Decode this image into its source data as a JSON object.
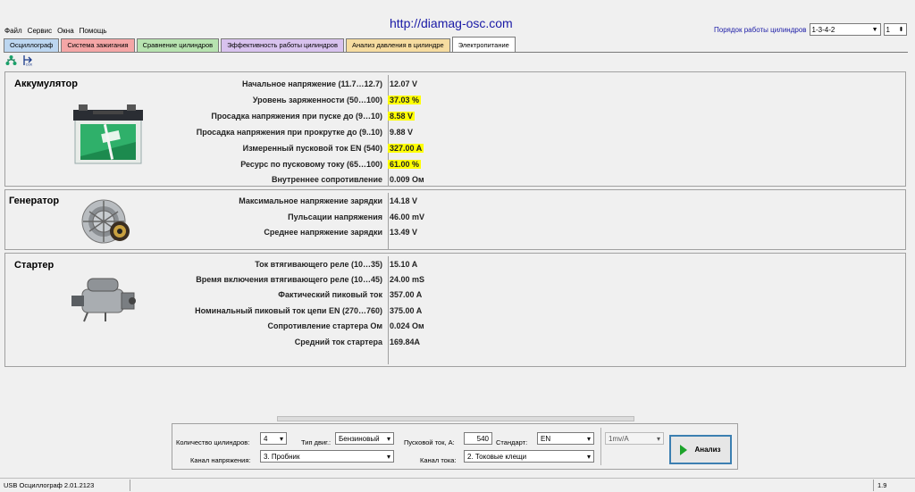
{
  "site_url": "http://diamag-osc.com",
  "menu": [
    "Файл",
    "Сервис",
    "Окна",
    "Помощь"
  ],
  "cylinder_order": {
    "label": "Порядок работы цилиндров",
    "value": "1-3-4-2",
    "stepper": "1"
  },
  "tabs": [
    {
      "label": "Осциллограф",
      "color": "#bcd6f0"
    },
    {
      "label": "Система зажигания",
      "color": "#f4a6a6"
    },
    {
      "label": "Сравнение цилиндров",
      "color": "#b7e3b0"
    },
    {
      "label": "Эффективность работы цилиндров",
      "color": "#d8c2ee"
    },
    {
      "label": "Анализ давления в цилиндре",
      "color": "#f6dca0"
    },
    {
      "label": "Электропитание",
      "color": "#ffffff",
      "active": true
    }
  ],
  "toolbar_icons": [
    "network-icon",
    "export-icon"
  ],
  "battery": {
    "title": "Аккумулятор",
    "rows": [
      {
        "label": "Начальное напряжение (11.7…12.7)",
        "value": "12.07 V",
        "highlight": false
      },
      {
        "label": "Уровень заряженности (50…100)",
        "value": "37.03 %",
        "highlight": true
      },
      {
        "label": "Просадка напряжения при пуске до (9…10)",
        "value": "8.58 V",
        "highlight": true
      },
      {
        "label": "Просадка напряжения при прокрутке до  (9..10)",
        "value": "9.88 V",
        "highlight": false
      },
      {
        "label": "Измеренный пусковой ток  EN (540)",
        "value": "327.00 A",
        "highlight": true
      },
      {
        "label": "Ресурс по пусковому току (65…100)",
        "value": "61.00 %",
        "highlight": true
      },
      {
        "label": "Внутреннее сопротивление",
        "value": "0.009 Ом",
        "highlight": false
      }
    ]
  },
  "generator": {
    "title": "Генератор",
    "rows": [
      {
        "label": "Максимальное напряжение зарядки",
        "value": "14.18 V"
      },
      {
        "label": "Пульсации напряжения",
        "value": "46.00 mV"
      },
      {
        "label": "Среднее напряжение зарядки",
        "value": "13.49 V"
      }
    ]
  },
  "starter": {
    "title": "Стартер",
    "rows": [
      {
        "label": "Ток втягивающего реле (10…35)",
        "value": "15.10 A"
      },
      {
        "label": "Время включения втягивающего реле (10…45)",
        "value": "24.00 mS"
      },
      {
        "label": "Фактический пиковый ток",
        "value": "357.00 A"
      },
      {
        "label": "Номинальный пиковый ток цепи EN (270…760)",
        "value": "375.00 A"
      },
      {
        "label": "Сопротивление стартера Ом",
        "value": "0.024 Ом"
      },
      {
        "label": "Средний ток стартера",
        "value": "169.84A"
      }
    ]
  },
  "controls": {
    "cyl_count_label": "Количество цилиндров:",
    "cyl_count_value": "4",
    "engine_type_label": "Тип двиг.:",
    "engine_type_value": "Бензиновый",
    "start_current_label": "Пусковой ток, А:",
    "start_current_value": "540",
    "standard_label": "Стандарт:",
    "standard_value": "EN",
    "scale_value": "1mv/A",
    "voltage_channel_label": "Канал напряжения:",
    "voltage_channel_value": "3. Пробник",
    "current_channel_label": "Канал тока:",
    "current_channel_value": "2. Токовые клещи",
    "analyze_label": "Анализ"
  },
  "status": {
    "left": "USB Осциллограф  2.01.2123",
    "right": "1.9"
  }
}
